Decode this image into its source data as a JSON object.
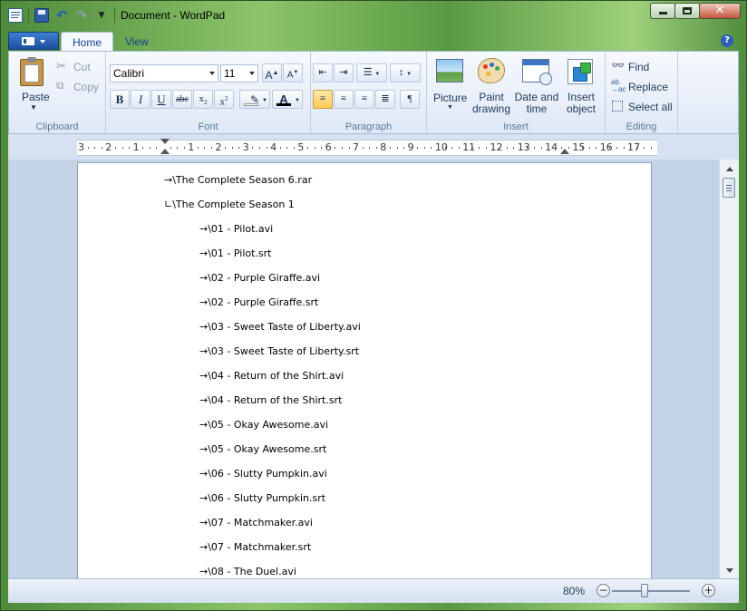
{
  "window": {
    "title": "Document - WordPad"
  },
  "tabs": {
    "home": "Home",
    "view": "View"
  },
  "clipboard": {
    "group": "Clipboard",
    "paste": "Paste",
    "cut": "Cut",
    "copy": "Copy"
  },
  "font": {
    "group": "Font",
    "family": "Calibri",
    "size": "11"
  },
  "paragraph": {
    "group": "Paragraph"
  },
  "insert": {
    "group": "Insert",
    "picture": "Picture",
    "paint_line1": "Paint",
    "paint_line2": "drawing",
    "datetime_line1": "Date and",
    "datetime_line2": "time",
    "object_line1": "Insert",
    "object_line2": "object"
  },
  "editing": {
    "group": "Editing",
    "find": "Find",
    "replace": "Replace",
    "select_all": "Select all"
  },
  "ruler": {
    "labels": [
      "3",
      "2",
      "1",
      "",
      "1",
      "2",
      "3",
      "4",
      "5",
      "6",
      "7",
      "8",
      "9",
      "10",
      "11",
      "12",
      "13",
      "14",
      "15",
      "16",
      "17"
    ]
  },
  "document": {
    "lines": [
      "→\\The Complete Season 6.rar",
      "∟\\The Complete Season 1",
      "→\\01 - Pilot.avi",
      "→\\01 - Pilot.srt",
      "→\\02 - Purple Giraffe.avi",
      "→\\02 - Purple Giraffe.srt",
      "→\\03 - Sweet Taste of Liberty.avi",
      "→\\03 - Sweet Taste of Liberty.srt",
      "→\\04 - Return of the Shirt.avi",
      "→\\04 - Return of the Shirt.srt",
      "→\\05 - Okay Awesome.avi",
      "→\\05 - Okay Awesome.srt",
      "→\\06 - Slutty Pumpkin.avi",
      "→\\06 - Slutty Pumpkin.srt",
      "→\\07 - Matchmaker.avi",
      "→\\07 - Matchmaker.srt",
      "→\\08 - The Duel.avi"
    ]
  },
  "status": {
    "zoom": "80%",
    "zoom_minus": "−",
    "zoom_plus": "+",
    "zoom_level": 0.42
  }
}
